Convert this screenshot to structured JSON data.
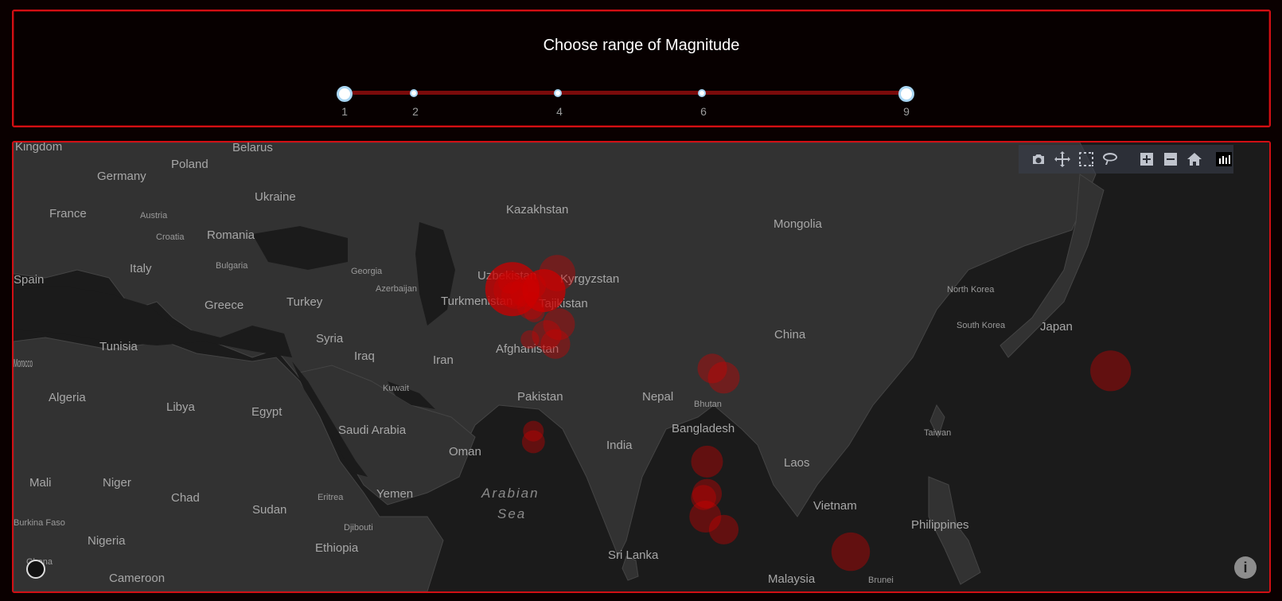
{
  "slider": {
    "title": "Choose range of Magnitude",
    "range": [
      1,
      9
    ],
    "marks": [
      "1",
      "2",
      "4",
      "6",
      "9"
    ]
  },
  "modebar": {
    "buttons": [
      "camera-icon",
      "pan-icon",
      "box-select-icon",
      "lasso-icon",
      "zoom-in-icon",
      "zoom-out-icon",
      "reset-home-icon",
      "plotly-logo"
    ]
  },
  "map": {
    "countries": [
      "Kingdom",
      "Belarus",
      "Poland",
      "Germany",
      "Ukraine",
      "France",
      "Austria",
      "Croatia",
      "Romania",
      "Italy",
      "Bulgaria",
      "Georgia",
      "Azerbaijan",
      "Spain",
      "Greece",
      "Turkey",
      "Tunisia",
      "Syria",
      "Iraq",
      "Iran",
      "Algeria",
      "Libya",
      "Egypt",
      "Kuwait",
      "Saudi Arabia",
      "Morocco",
      "Mali",
      "Niger",
      "Chad",
      "Sudan",
      "Eritrea",
      "Djibouti",
      "Yemen",
      "Oman",
      "Burkina Faso",
      "Nigeria",
      "Ethiopia",
      "Ghana",
      "Cameroon",
      "Kazakhstan",
      "Uzbekistan",
      "Turkmenistan",
      "Kyrgyzstan",
      "Tajikistan",
      "Afghanistan",
      "Pakistan",
      "India",
      "Nepal",
      "Bhutan",
      "Bangladesh",
      "Sri Lanka",
      "Mongolia",
      "China",
      "North Korea",
      "South Korea",
      "Japan",
      "Taiwan",
      "Laos",
      "Vietnam",
      "Philippines",
      "Malaysia",
      "Brunei"
    ],
    "sea_labels": [
      "Arabian",
      "Sea"
    ],
    "marker_color": "#ff0000",
    "earthquakes": [
      {
        "lat": 37.5,
        "lon": 70.8,
        "mag": 4.6
      },
      {
        "lat": 36.5,
        "lon": 70.9,
        "mag": 5.1
      },
      {
        "lat": 36.6,
        "lon": 71.1,
        "mag": 6.0
      },
      {
        "lat": 35.8,
        "lon": 71.4,
        "mag": 4.8
      },
      {
        "lat": 36.2,
        "lon": 72.5,
        "mag": 4.9
      },
      {
        "lat": 37.0,
        "lon": 73.5,
        "mag": 4.7
      },
      {
        "lat": 36.4,
        "lon": 74.7,
        "mag": 5.5
      },
      {
        "lat": 38.7,
        "lon": 76.2,
        "mag": 5.2
      },
      {
        "lat": 34.4,
        "lon": 73.2,
        "mag": 4.8
      },
      {
        "lat": 33.6,
        "lon": 73.6,
        "mag": 4.5
      },
      {
        "lat": 32.0,
        "lon": 76.4,
        "mag": 5.0
      },
      {
        "lat": 30.6,
        "lon": 75.0,
        "mag": 4.9
      },
      {
        "lat": 30.0,
        "lon": 73.1,
        "mag": 4.4
      },
      {
        "lat": 29.4,
        "lon": 76.0,
        "mag": 4.9
      },
      {
        "lat": 26.2,
        "lon": 93.8,
        "mag": 4.9
      },
      {
        "lat": 25.0,
        "lon": 95.1,
        "mag": 5.0
      },
      {
        "lat": 18.0,
        "lon": 73.5,
        "mag": 4.5
      },
      {
        "lat": 16.6,
        "lon": 73.5,
        "mag": 4.6
      },
      {
        "lat": 14.0,
        "lon": 93.2,
        "mag": 5.0
      },
      {
        "lat": 9.8,
        "lon": 93.2,
        "mag": 4.9
      },
      {
        "lat": 9.3,
        "lon": 92.8,
        "mag": 4.7
      },
      {
        "lat": 6.8,
        "lon": 93.0,
        "mag": 5.0
      },
      {
        "lat": 5.1,
        "lon": 95.1,
        "mag": 4.9
      },
      {
        "lat": 2.2,
        "lon": 109.5,
        "mag": 5.3
      },
      {
        "lat": 25.9,
        "lon": 139.0,
        "mag": 5.4
      }
    ]
  }
}
